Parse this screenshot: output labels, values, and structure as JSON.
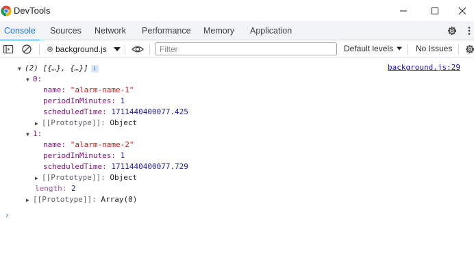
{
  "window": {
    "title": "DevTools",
    "controls": [
      "minimize",
      "maximize",
      "close"
    ]
  },
  "tabs": [
    {
      "label": "Console",
      "active": true
    },
    {
      "label": "Sources",
      "active": false
    },
    {
      "label": "Network",
      "active": false
    },
    {
      "label": "Performance",
      "active": false
    },
    {
      "label": "Memory",
      "active": false
    },
    {
      "label": "Application",
      "active": false
    }
  ],
  "toolbar": {
    "context": "background.js",
    "filter_placeholder": "Filter",
    "levels": "Default levels",
    "issues": "No Issues"
  },
  "console": {
    "source": "background.js:29",
    "summary_count": "(2)",
    "summary_preview": "[{…}, {…}]",
    "info_badge": "i",
    "items": [
      {
        "index": "0:",
        "name_key": "name:",
        "name_value": "\"alarm-name-1\"",
        "period_key": "periodInMinutes:",
        "period_value": "1",
        "time_key": "scheduledTime:",
        "time_value": "1711440400077.425",
        "proto_key": "[[Prototype]]:",
        "proto_value": "Object"
      },
      {
        "index": "1:",
        "name_key": "name:",
        "name_value": "\"alarm-name-2\"",
        "period_key": "periodInMinutes:",
        "period_value": "1",
        "time_key": "scheduledTime:",
        "time_value": "1711440400077.729",
        "proto_key": "[[Prototype]]:",
        "proto_value": "Object"
      }
    ],
    "length_key": "length:",
    "length_value": "2",
    "array_proto_key": "[[Prototype]]:",
    "array_proto_value": "Array(0)",
    "prompt_symbol": "›"
  },
  "colors": {
    "accent": "#1a73e8",
    "key": "#881280",
    "string": "#c41a16",
    "number": "#1a1aa6"
  }
}
